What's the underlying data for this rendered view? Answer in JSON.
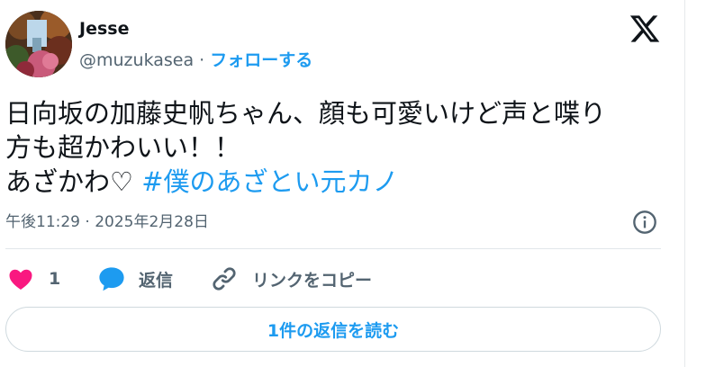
{
  "author": {
    "name": "Jesse",
    "handle": "@muzukasea",
    "separator": " · ",
    "follow_label": "フォローする"
  },
  "post": {
    "lines": [
      "日向坂の加藤史帆ちゃん、顔も可愛いけど声と喋り",
      "方も超かわいい！！",
      "あざかわ♡ "
    ],
    "hashtag": "#僕のあざとい元カノ"
  },
  "meta": {
    "timestamp": "午後11:29 · 2025年2月28日"
  },
  "actions": {
    "like_count": "1",
    "reply_label": "返信",
    "copy_link_label": "リンクをコピー"
  },
  "read_replies_label": "1件の返信を読む",
  "colors": {
    "accent": "#1d9bf0",
    "like": "#f91880",
    "secondary_text": "#536471",
    "primary_text": "#0f1419"
  },
  "icons": {
    "brand": "x-logo-icon",
    "info": "info-icon",
    "like": "heart-icon",
    "reply": "speech-bubble-icon",
    "copy": "link-icon"
  }
}
